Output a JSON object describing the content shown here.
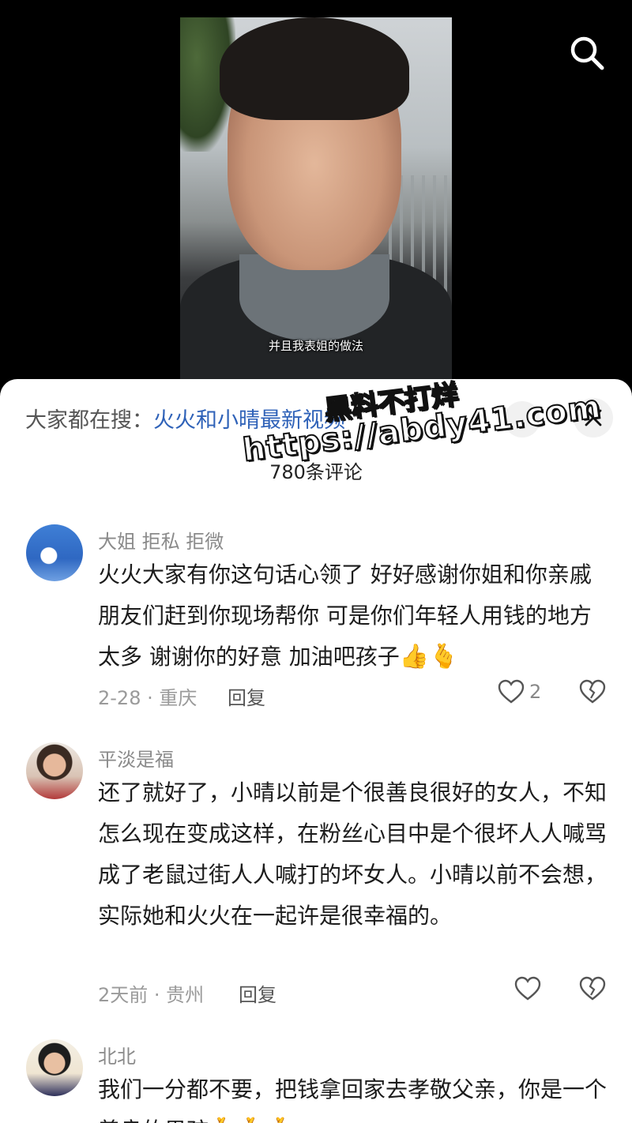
{
  "video": {
    "subtitle": "并且我表姐的做法"
  },
  "sheet": {
    "search_prefix": "大家都在搜：",
    "search_term": "火火和小晴最新视频",
    "comment_count": "780条评论"
  },
  "watermark": {
    "line1": "黑料不打烊",
    "line2": "https://abdy41.com"
  },
  "comments": [
    {
      "username": "大姐  拒私  拒微",
      "text": "火火大家有你这句话心领了 好好感谢你姐和你亲戚朋友们赶到你现场帮你 可是你们年轻人用钱的地方太多 谢谢你的好意 加油吧孩子",
      "emojis": "👍🫰",
      "meta": "2-28 · 重庆",
      "reply_label": "回复",
      "likes": "2"
    },
    {
      "username": "平淡是福",
      "text": "还了就好了，小晴以前是个很善良很好的女人，不知怎么现在变成这样，在粉丝心目中是个很坏人人喊骂成了老鼠过街人人喊打的坏女人。小晴以前不会想，实际她和火火在一起许是很幸福的。",
      "meta": "2天前 · 贵州",
      "reply_label": "回复",
      "likes": ""
    },
    {
      "username": "北北",
      "text": "我们一分都不要，把钱拿回家去孝敬父亲，你是一个善良的男孩",
      "emojis": "🫰🫰🫰"
    }
  ]
}
